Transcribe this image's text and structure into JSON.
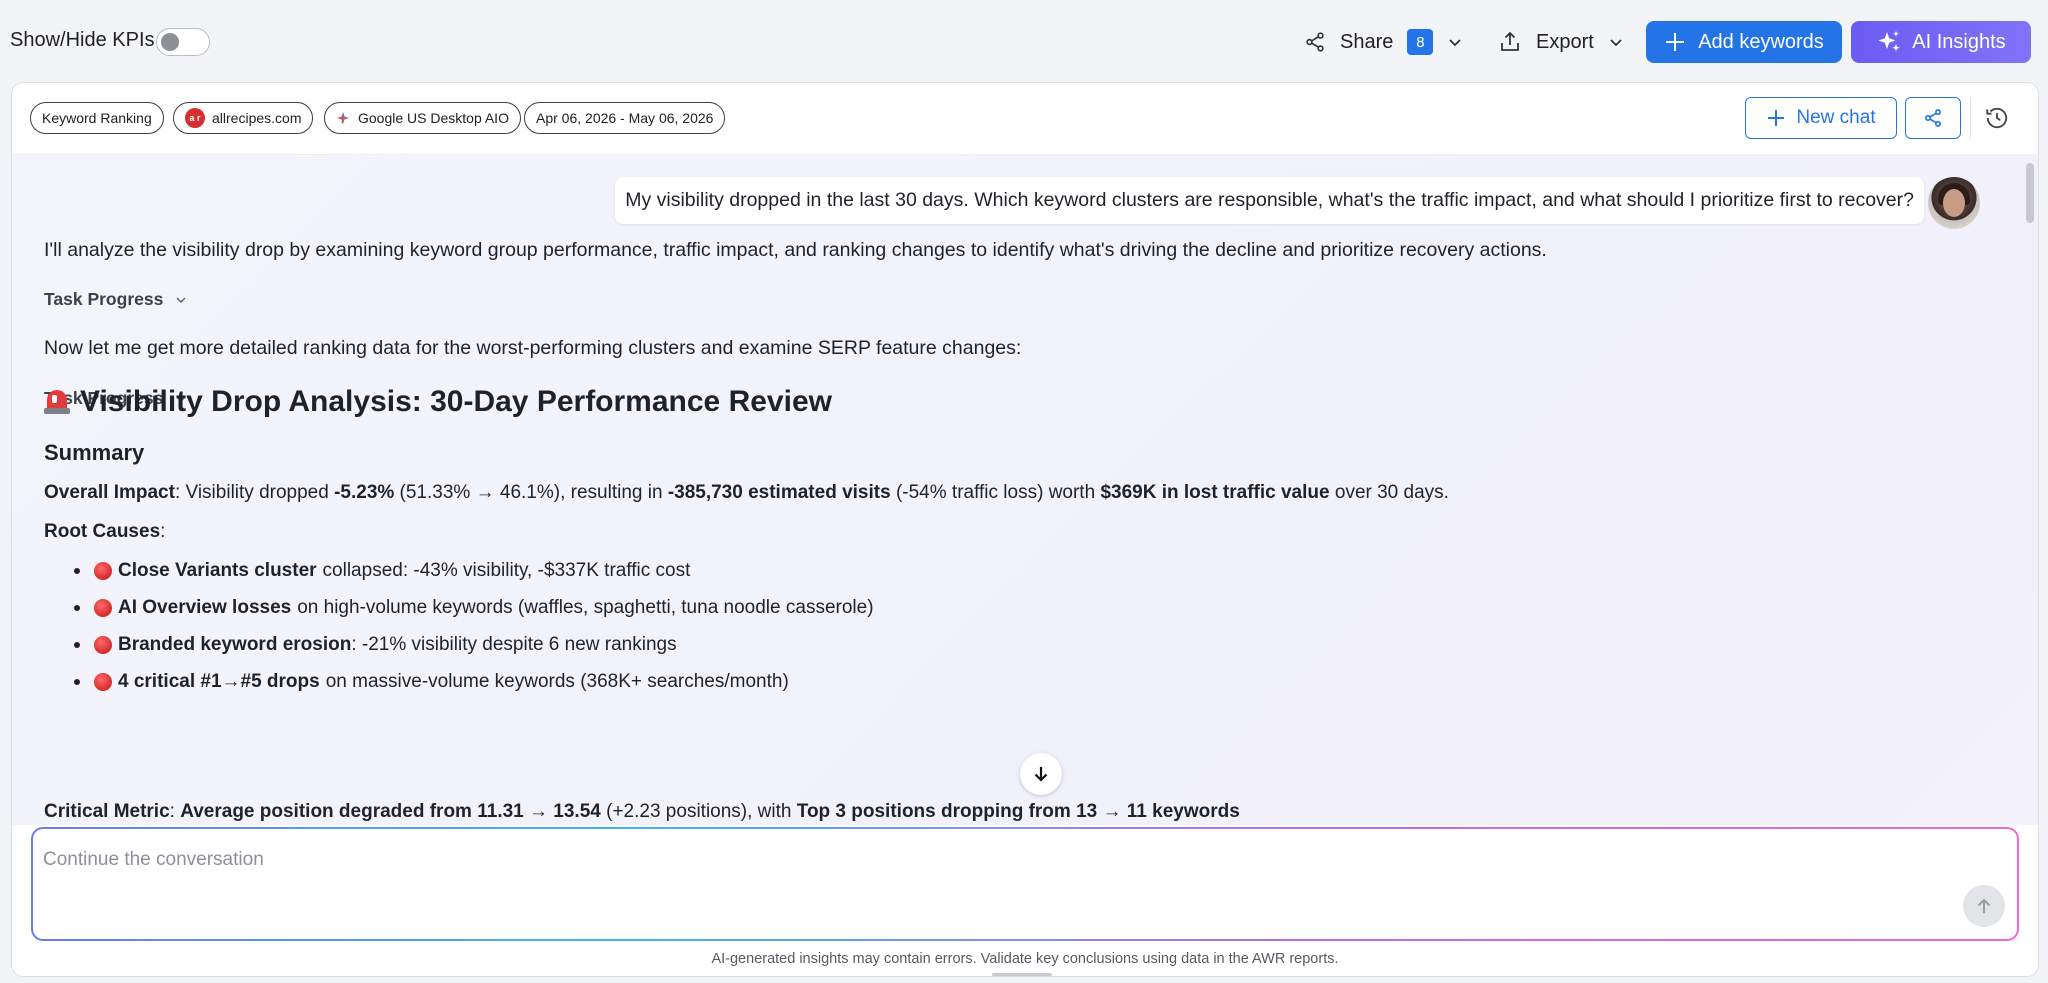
{
  "topbar": {
    "kpi_label": "Show/Hide KPIs",
    "share_label": "Share",
    "share_count": "8",
    "export_label": "Export",
    "add_keywords_label": "Add keywords",
    "ai_insights_label": "AI Insights"
  },
  "filters": [
    {
      "label": "Keyword Ranking"
    },
    {
      "label": "allrecipes.com",
      "logo_text": "a r"
    },
    {
      "label": "Google US Desktop AIO"
    },
    {
      "label": "Apr 06, 2026 - May 06, 2026"
    }
  ],
  "panel": {
    "new_chat_label": "New chat"
  },
  "chat": {
    "user_message": "My visibility dropped in the last 30 days. Which keyword clusters are responsible, what's the traffic impact, and what should I prioritize first to recover?",
    "intro": "I'll analyze the visibility drop by examining keyword group performance, traffic impact, and ranking changes to identify what's driving the decline and prioritize recovery actions.",
    "task_progress_1": "Task Progress",
    "followup": "Now let me get more detailed ranking data for the worst-performing clusters and examine SERP feature changes:",
    "task_progress_2": "Task Progress",
    "heading": "Visibility Drop Analysis: 30-Day Performance Review",
    "summary_heading": "Summary",
    "overall": {
      "label": "Overall Impact",
      "t1": ": Visibility dropped ",
      "b1": "-5.23%",
      "t2": " (51.33% → 46.1%), resulting in ",
      "b2": "-385,730 estimated visits",
      "t3": " (-54% traffic loss) worth ",
      "b3": "$369K in lost traffic value",
      "t4": " over 30 days."
    },
    "root_causes_label": "Root Causes",
    "root_causes_colon": ":",
    "bullets": [
      {
        "bold": "Close Variants cluster",
        "text": "collapsed: -43% visibility, -$337K traffic cost"
      },
      {
        "bold": "AI Overview losses",
        "text": "on high-volume keywords (waffles, spaghetti, tuna noodle casserole)"
      },
      {
        "bold": "Branded keyword erosion",
        "text": ": -21% visibility despite 6 new rankings"
      },
      {
        "bold": "4 critical #1→#5 drops",
        "text": "on massive-volume keywords (368K+ searches/month)"
      }
    ],
    "critical": {
      "label": "Critical Metric",
      "t1": ": ",
      "b1": "Average position degraded from 11.31 → 13.54",
      "t2": " (+2.23 positions), with ",
      "b2": "Top 3 positions dropping from 13 → 11 keywords"
    }
  },
  "composer": {
    "placeholder": "Continue the conversation",
    "disclaimer": "AI-generated insights may contain errors. Validate key conclusions using data in the AWR reports."
  },
  "colors": {
    "primary": "#2474e8",
    "ai_gradient_start": "#6a5cf2",
    "alert_red": "#d42a2a"
  }
}
